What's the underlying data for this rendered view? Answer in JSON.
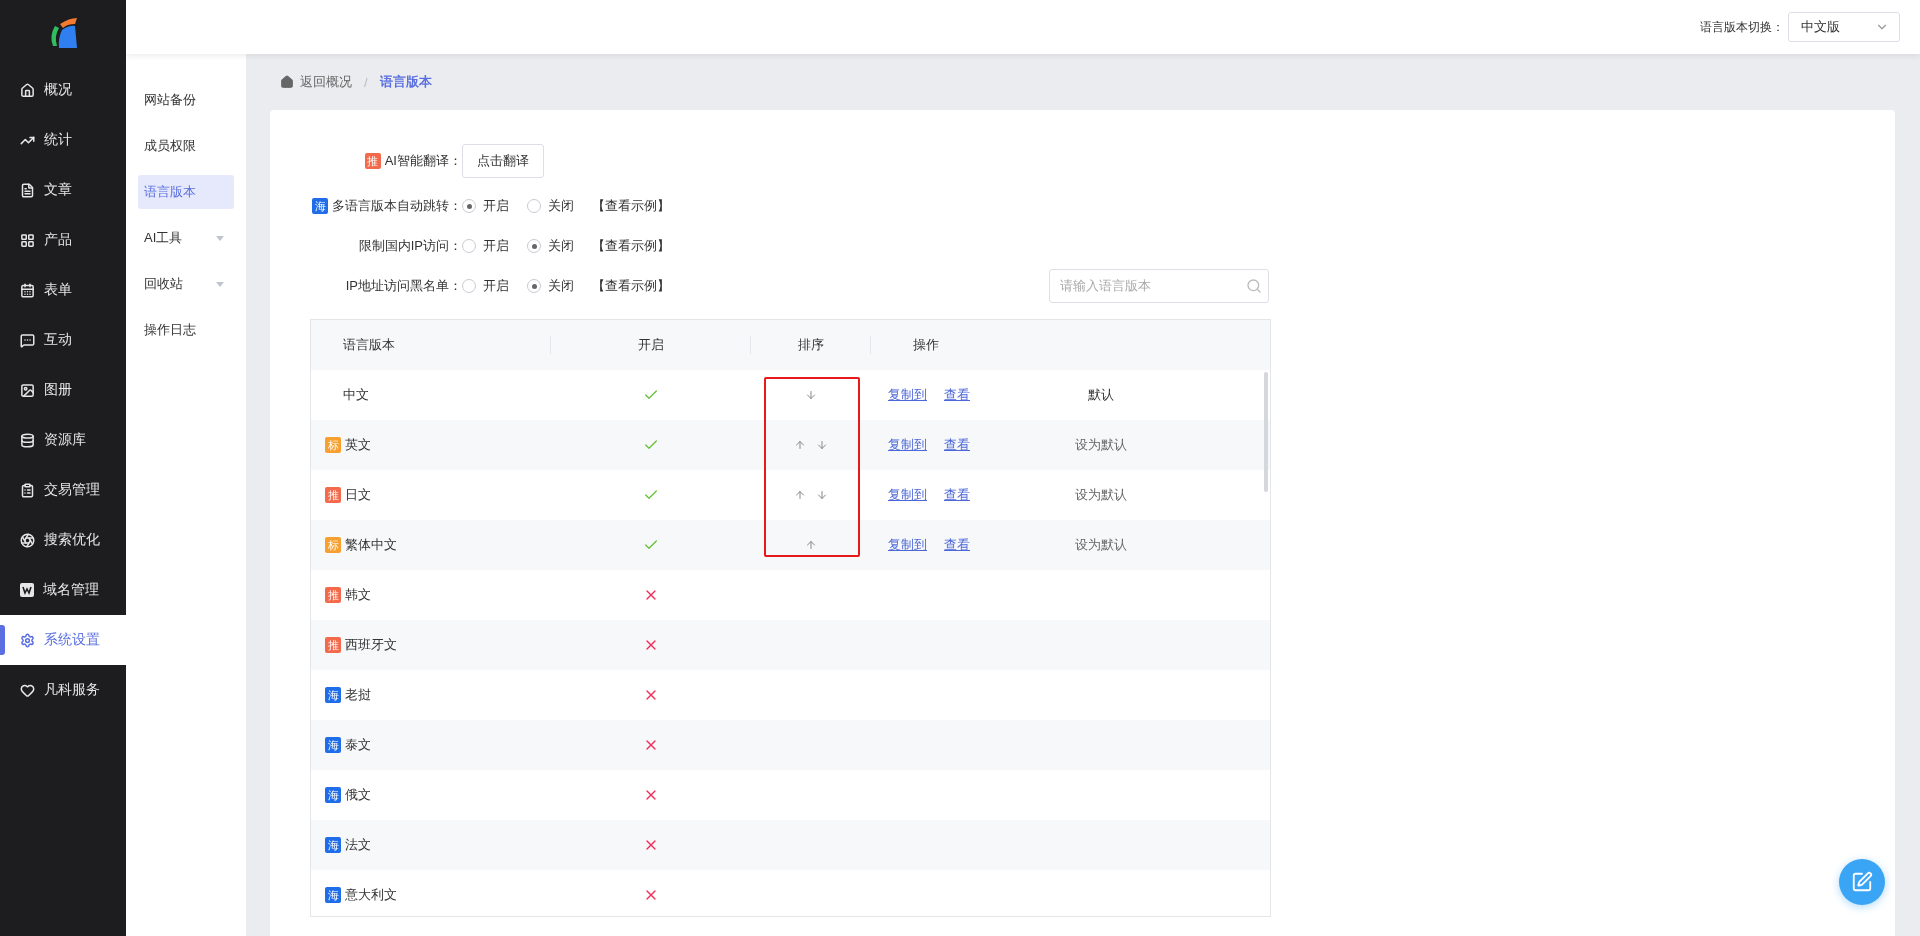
{
  "top_bar": {
    "switch_label": "语言版本切换：",
    "select_value": "中文版"
  },
  "nav": [
    {
      "label": "概况",
      "selected": false
    },
    {
      "label": "统计",
      "selected": false
    },
    {
      "label": "文章",
      "selected": false
    },
    {
      "label": "产品",
      "selected": false
    },
    {
      "label": "表单",
      "selected": false
    },
    {
      "label": "互动",
      "selected": false
    },
    {
      "label": "图册",
      "selected": false
    },
    {
      "label": "资源库",
      "selected": false
    },
    {
      "label": "交易管理",
      "selected": false
    },
    {
      "label": "搜索优化",
      "selected": false
    },
    {
      "label": "域名管理",
      "selected": false
    },
    {
      "label": "系统设置",
      "selected": true
    },
    {
      "label": "凡科服务",
      "selected": false
    }
  ],
  "sub_nav": [
    {
      "label": "网站备份",
      "selected": false,
      "expandable": false
    },
    {
      "label": "成员权限",
      "selected": false,
      "expandable": false
    },
    {
      "label": "语言版本",
      "selected": true,
      "expandable": false
    },
    {
      "label": "AI工具",
      "selected": false,
      "expandable": true
    },
    {
      "label": "回收站",
      "selected": false,
      "expandable": true
    },
    {
      "label": "操作日志",
      "selected": false,
      "expandable": false
    }
  ],
  "breadcrumb": {
    "back": "返回概况",
    "separator": "/",
    "current": "语言版本"
  },
  "settings": [
    {
      "kind": "button",
      "badge": {
        "text": "推",
        "color": "#f26a4b"
      },
      "label": "AI智能翻译：",
      "button": "点击翻译"
    },
    {
      "kind": "radio",
      "badge": {
        "text": "海",
        "color": "#1f6de8"
      },
      "label": "多语言版本自动跳转：",
      "options": [
        {
          "label": "开启",
          "selected": true
        },
        {
          "label": "关闭",
          "selected": false
        }
      ],
      "link": "【查看示例】"
    },
    {
      "kind": "radio",
      "label": "限制国内IP访问：",
      "options": [
        {
          "label": "开启",
          "selected": false
        },
        {
          "label": "关闭",
          "selected": true
        }
      ],
      "link": "【查看示例】"
    },
    {
      "kind": "radio",
      "label": "IP地址访问黑名单：",
      "options": [
        {
          "label": "开启",
          "selected": false
        },
        {
          "label": "关闭",
          "selected": true
        }
      ],
      "link": "【查看示例】"
    }
  ],
  "search": {
    "placeholder": "请输入语言版本"
  },
  "table": {
    "columns": [
      "语言版本",
      "开启",
      "排序",
      "操作"
    ],
    "rows": [
      {
        "name": "中文",
        "enabled": true,
        "sort": {
          "up": false,
          "down": true
        },
        "actions": [
          "复制到",
          "查看"
        ],
        "default": {
          "label": "默认",
          "is_default": true
        }
      },
      {
        "name": "英文",
        "badge": {
          "text": "标",
          "color": "#f7a030"
        },
        "enabled": true,
        "sort": {
          "up": true,
          "down": true
        },
        "actions": [
          "复制到",
          "查看"
        ],
        "default": {
          "label": "设为默认",
          "is_default": false
        }
      },
      {
        "name": "日文",
        "badge": {
          "text": "推",
          "color": "#f26a4b"
        },
        "enabled": true,
        "sort": {
          "up": true,
          "down": true
        },
        "actions": [
          "复制到",
          "查看"
        ],
        "default": {
          "label": "设为默认",
          "is_default": false
        }
      },
      {
        "name": "繁体中文",
        "badge": {
          "text": "标",
          "color": "#f7a030"
        },
        "enabled": true,
        "sort": {
          "up": true,
          "down": false
        },
        "actions": [
          "复制到",
          "查看"
        ],
        "default": {
          "label": "设为默认",
          "is_default": false
        }
      },
      {
        "name": "韩文",
        "badge": {
          "text": "推",
          "color": "#f26a4b"
        },
        "enabled": false
      },
      {
        "name": "西班牙文",
        "badge": {
          "text": "推",
          "color": "#f26a4b"
        },
        "enabled": false
      },
      {
        "name": "老挝",
        "badge": {
          "text": "海",
          "color": "#1f6de8"
        },
        "enabled": false
      },
      {
        "name": "泰文",
        "badge": {
          "text": "海",
          "color": "#1f6de8"
        },
        "enabled": false
      },
      {
        "name": "俄文",
        "badge": {
          "text": "海",
          "color": "#1f6de8"
        },
        "enabled": false
      },
      {
        "name": "法文",
        "badge": {
          "text": "海",
          "color": "#1f6de8"
        },
        "enabled": false
      },
      {
        "name": "意大利文",
        "badge": {
          "text": "海",
          "color": "#1f6de8"
        },
        "enabled": false
      }
    ]
  }
}
